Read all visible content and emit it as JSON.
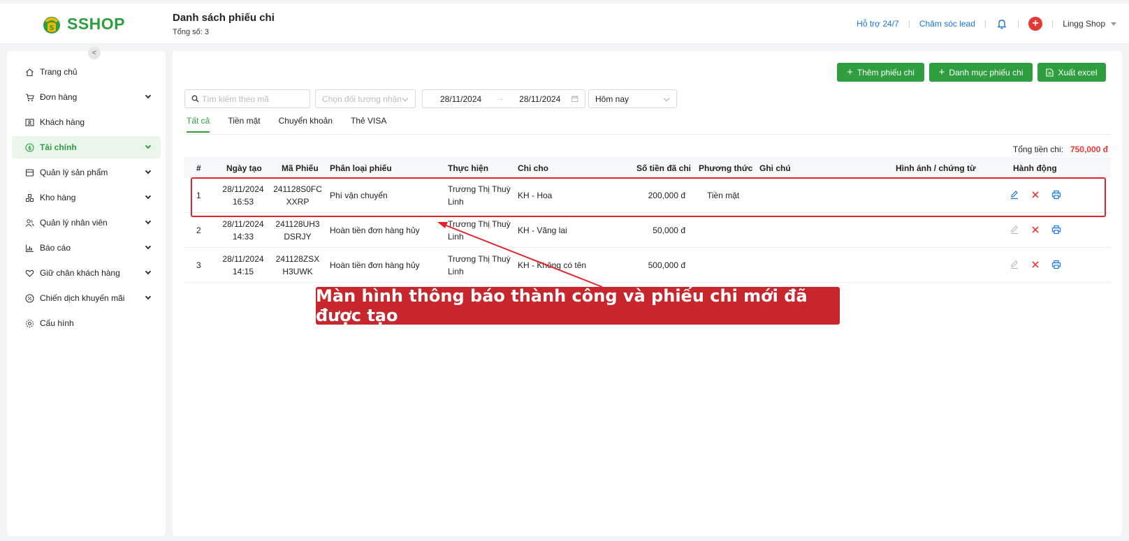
{
  "brand": {
    "name": "SSHOP",
    "color": "#2e9e3f"
  },
  "header": {
    "title": "Danh sách phiếu chi",
    "count": "Tổng số: 3",
    "support": "Hỗ trợ 24/7",
    "lead": "Chăm sóc lead",
    "user": "Lingg Shop"
  },
  "sidebar": {
    "items": [
      {
        "label": "Trang chủ",
        "icon": "home-icon"
      },
      {
        "label": "Đơn hàng",
        "icon": "cart-icon"
      },
      {
        "label": "Khách hàng",
        "icon": "contact-icon"
      },
      {
        "label": "Tài chính",
        "icon": "dollar-icon"
      },
      {
        "label": "Quản lý sản phẩm",
        "icon": "box-icon"
      },
      {
        "label": "Kho hàng",
        "icon": "warehouse-icon"
      },
      {
        "label": "Quản lý nhân viên",
        "icon": "people-icon"
      },
      {
        "label": "Báo cáo",
        "icon": "chart-icon"
      },
      {
        "label": "Giữ chân khách hàng",
        "icon": "heart-icon"
      },
      {
        "label": "Chiến dịch khuyến mãi",
        "icon": "discount-icon"
      },
      {
        "label": "Cấu hình",
        "icon": "settings-icon"
      }
    ]
  },
  "toolbar": {
    "add_label": "Thêm phiếu chi",
    "category_label": "Danh mục phiếu chi",
    "export_label": "Xuất excel"
  },
  "filters": {
    "search_placeholder": "Tìm kiếm theo mã",
    "target_placeholder": "Chọn đối tượng nhận",
    "date_from": "28/11/2024",
    "date_to": "28/11/2024",
    "date_sep": "→",
    "period": "Hôm nay"
  },
  "tabs": [
    "Tất cả",
    "Tiền mặt",
    "Chuyển khoản",
    "Thẻ VISA"
  ],
  "summary": {
    "label": "Tổng tiền chi:",
    "value": "750,000 đ"
  },
  "table": {
    "headers": {
      "index": "#",
      "date": "Ngày tạo",
      "code": "Mã Phiếu",
      "type": "Phân loại phiếu",
      "by": "Thực hiện",
      "to": "Chi cho",
      "amount": "Số tiền đã chi",
      "method": "Phương thức",
      "note": "Ghi chú",
      "image": "Hình ảnh / chứng từ",
      "actions": "Hành động"
    },
    "rows": [
      {
        "index": "1",
        "date": "28/11/2024",
        "time": "16:53",
        "code1": "241128S0FC",
        "code2": "XXRP",
        "type": "Phí vận chuyển",
        "by1": "Trương Thị Thuỳ",
        "by2": "Linh",
        "to": "KH - Hoa",
        "amount": "200,000 đ",
        "method": "Tiền mặt"
      },
      {
        "index": "2",
        "date": "28/11/2024",
        "time": "14:33",
        "code1": "241128UH3",
        "code2": "DSRJY",
        "type": "Hoàn tiền đơn hàng hủy",
        "by1": "Trương Thị Thuỳ",
        "by2": "Linh",
        "to": "KH - Vãng lai",
        "amount": "50,000 đ",
        "method": ""
      },
      {
        "index": "3",
        "date": "28/11/2024",
        "time": "14:15",
        "code1": "241128ZSX",
        "code2": "H3UWK",
        "type": "Hoàn tiền đơn hàng hủy",
        "by1": "Trương Thị Thuỳ",
        "by2": "Linh",
        "to": "KH - Không có tên",
        "amount": "500,000 đ",
        "method": ""
      }
    ]
  },
  "annotation": {
    "text": "Màn hình thông báo thành công và phiếu chi mới đã được tạo",
    "color": "#c7262c"
  }
}
